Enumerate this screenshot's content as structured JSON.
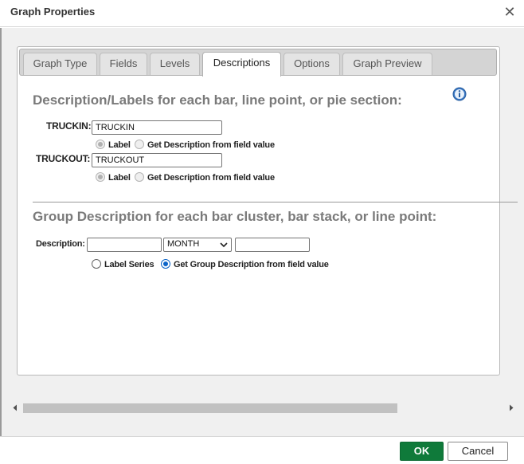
{
  "dialog": {
    "title": "Graph Properties",
    "close_icon": "close-icon"
  },
  "tabs": [
    {
      "label": "Graph Type",
      "active": false
    },
    {
      "label": "Fields",
      "active": false
    },
    {
      "label": "Levels",
      "active": false
    },
    {
      "label": "Descriptions",
      "active": true
    },
    {
      "label": "Options",
      "active": false
    },
    {
      "label": "Graph Preview",
      "active": false
    }
  ],
  "descriptions": {
    "heading": "Description/Labels for each bar, line point, or pie section:",
    "info_icon": "info-icon",
    "fields": [
      {
        "label": "TRUCKIN:",
        "value": "TRUCKIN",
        "radio_label": "Label",
        "radio_field": "Get Description from field value",
        "selected": "label",
        "disabled": true
      },
      {
        "label": "TRUCKOUT:",
        "value": "TRUCKOUT",
        "radio_label": "Label",
        "radio_field": "Get Description from field value",
        "selected": "label",
        "disabled": true
      }
    ]
  },
  "group": {
    "heading": "Group Description for each bar cluster, bar stack, or line point:",
    "description_label": "Description:",
    "prefix_value": "",
    "field_select": "MONTH",
    "suffix_value": "",
    "radio_series": "Label Series",
    "radio_field": "Get Group Description from field value",
    "selected": "field"
  },
  "footer": {
    "ok_label": "OK",
    "cancel_label": "Cancel"
  },
  "colors": {
    "ok_button": "#0f7a3a",
    "radio_selected": "#0b64c8",
    "heading": "#7a7a7a",
    "info_icon": "#3b78c4"
  }
}
